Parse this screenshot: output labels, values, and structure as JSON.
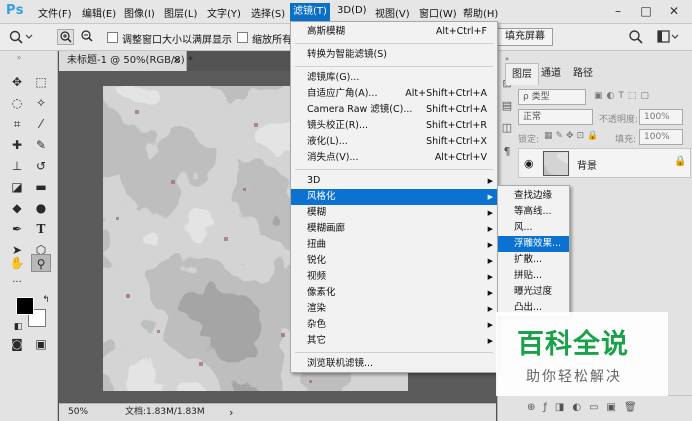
{
  "menubar": {
    "logo": "Ps",
    "items": [
      "文件(F)",
      "编辑(E)",
      "图像(I)",
      "图层(L)",
      "文字(Y)",
      "选择(S)",
      "滤镜(T)",
      "3D(D)",
      "视图(V)",
      "窗口(W)",
      "帮助(H)"
    ],
    "active_index": 6,
    "window_controls": [
      "–",
      "□",
      "✕"
    ]
  },
  "options_bar": {
    "resize_label": "调整窗口大小以满屏显示",
    "zoom_all_label": "缩放所有窗",
    "fill_screen_label": "填充屏幕"
  },
  "document": {
    "tab_title": "未标题-1 @ 50%(RGB/8) *",
    "tab_close": "×",
    "zoom": "50%",
    "doc_info": "文档:1.83M/1.83M",
    "status_arrow": "›"
  },
  "layers_panel": {
    "tabs": [
      "图层",
      "通道",
      "路径"
    ],
    "kind_label": "ρ 类型",
    "blend_mode": "正常",
    "opacity_label": "不透明度:",
    "opacity_value": "100%",
    "lock_label": "锁定:",
    "fill_label": "填充:",
    "fill_value": "100%",
    "layer_name": "背景"
  },
  "filter_menu": {
    "items": [
      {
        "label": "高斯模糊",
        "shortcut": "Alt+Ctrl+F"
      },
      {
        "label": "转换为智能滤镜(S)",
        "shortcut": ""
      },
      {
        "label": "滤镜库(G)...",
        "shortcut": ""
      },
      {
        "label": "自适应广角(A)...",
        "shortcut": "Alt+Shift+Ctrl+A"
      },
      {
        "label": "Camera Raw 滤镜(C)...",
        "shortcut": "Shift+Ctrl+A"
      },
      {
        "label": "镜头校正(R)...",
        "shortcut": "Shift+Ctrl+R"
      },
      {
        "label": "液化(L)...",
        "shortcut": "Shift+Ctrl+X"
      },
      {
        "label": "消失点(V)...",
        "shortcut": "Alt+Ctrl+V"
      },
      {
        "label": "3D",
        "shortcut": ""
      },
      {
        "label": "风格化",
        "shortcut": ""
      },
      {
        "label": "模糊",
        "shortcut": ""
      },
      {
        "label": "模糊画廊",
        "shortcut": ""
      },
      {
        "label": "扭曲",
        "shortcut": ""
      },
      {
        "label": "锐化",
        "shortcut": ""
      },
      {
        "label": "视频",
        "shortcut": ""
      },
      {
        "label": "像素化",
        "shortcut": ""
      },
      {
        "label": "渲染",
        "shortcut": ""
      },
      {
        "label": "杂色",
        "shortcut": ""
      },
      {
        "label": "其它",
        "shortcut": ""
      },
      {
        "label": "浏览联机滤镜...",
        "shortcut": ""
      }
    ],
    "highlighted_index": 9
  },
  "stylize_menu": {
    "items": [
      "查找边缘",
      "等高线...",
      "风...",
      "浮雕效果...",
      "扩散...",
      "拼贴...",
      "曝光过度",
      "凸出..."
    ],
    "highlighted_index": 3
  },
  "watermark": {
    "title": "百科全说",
    "subtitle": "助你轻松解决"
  },
  "colors": {
    "menu_highlight": "#0b72d1",
    "watermark_green": "#19a24a"
  }
}
